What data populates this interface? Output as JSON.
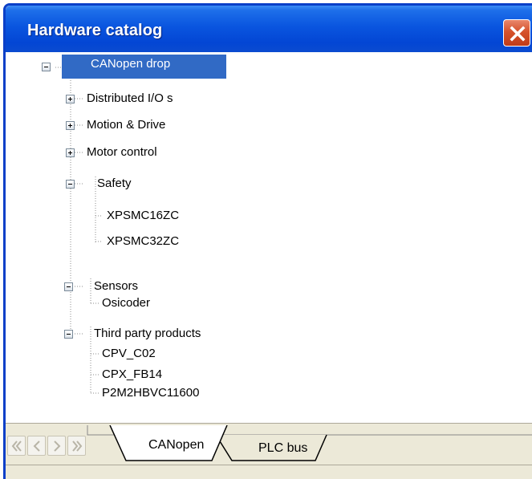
{
  "window": {
    "title": "Hardware catalog"
  },
  "tree": {
    "root": {
      "label": "CANopen drop",
      "expanded": true,
      "selected": true
    },
    "groups": [
      {
        "label": "Distributed I/O s",
        "expanded": false
      },
      {
        "label": "Motion & Drive",
        "expanded": false
      },
      {
        "label": "Motor control",
        "expanded": false
      },
      {
        "label": "Safety",
        "expanded": true,
        "children": [
          "XPSMC16ZC",
          "XPSMC32ZC"
        ]
      },
      {
        "label": "Sensors",
        "expanded": true,
        "children": [
          "Osicoder"
        ]
      },
      {
        "label": "Third party products",
        "expanded": true,
        "children": [
          "CPV_C02",
          "CPX_FB14",
          "P2M2HBVC11600"
        ]
      }
    ]
  },
  "tabs": [
    {
      "label": "CANopen",
      "active": true
    },
    {
      "label": "PLC bus",
      "active": false
    }
  ],
  "colors": {
    "title_bar": "#0346D4",
    "selection": "#316AC5",
    "close_button": "#D6522C",
    "chrome": "#ECE9D8"
  }
}
